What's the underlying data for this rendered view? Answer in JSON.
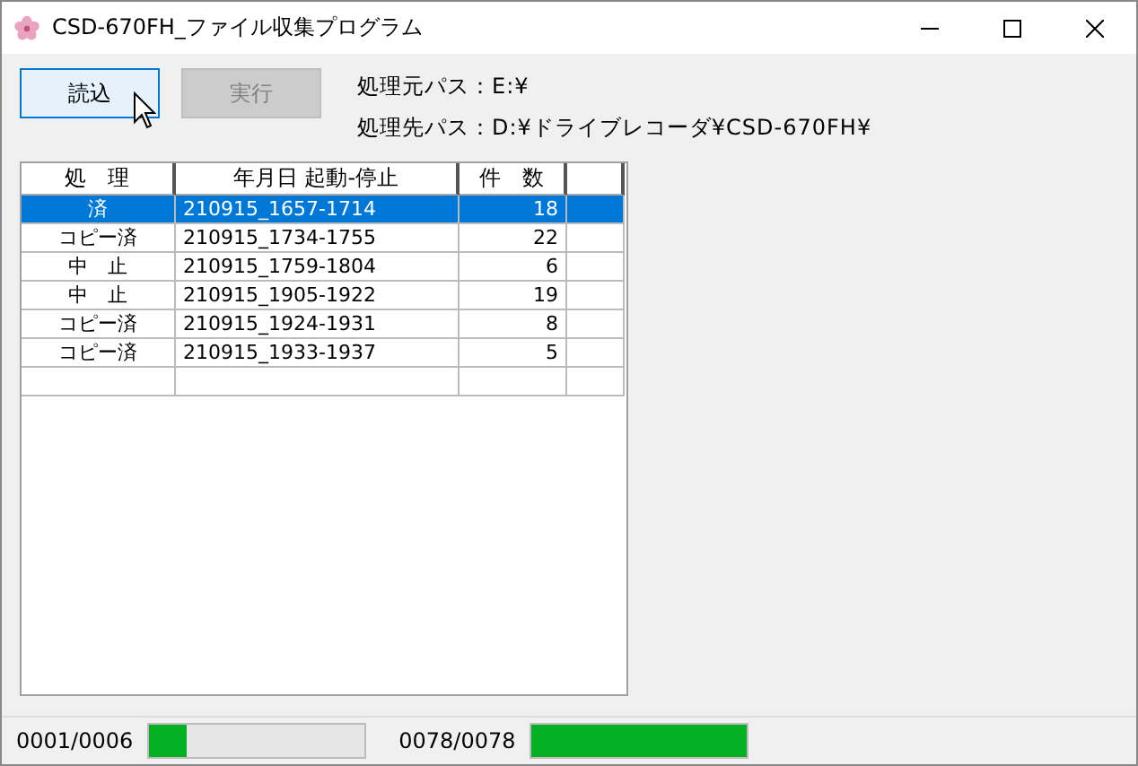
{
  "window": {
    "title": "CSD-670FH_ファイル収集プログラム"
  },
  "buttons": [
    {
      "label": "読込",
      "disabled": false
    },
    {
      "label": "実行",
      "disabled": true
    }
  ],
  "paths": [
    "処理元パス：E:¥",
    "処理先パス：D:¥ドライブレコーダ¥CSD-670FH¥"
  ],
  "table": {
    "columns": [
      "処　理",
      "年月日 起動-停止",
      "件　数"
    ],
    "rows": [
      {
        "cells": [
          "済",
          "210915_1657-1714",
          "18"
        ],
        "selected": true
      },
      {
        "cells": [
          "コピー済",
          "210915_1734-1755",
          "22"
        ],
        "selected": false
      },
      {
        "cells": [
          "中　止",
          "210915_1759-1804",
          "6"
        ],
        "selected": false
      },
      {
        "cells": [
          "中　止",
          "210915_1905-1922",
          "19"
        ],
        "selected": false
      },
      {
        "cells": [
          "コピー済",
          "210915_1924-1931",
          "8"
        ],
        "selected": false
      },
      {
        "cells": [
          "コピー済",
          "210915_1933-1937",
          "5"
        ],
        "selected": false
      }
    ]
  },
  "status_bar": [
    {
      "count": "0001/0006",
      "level": 0.17
    },
    {
      "count": "0078/0078",
      "level": 1
    }
  ]
}
